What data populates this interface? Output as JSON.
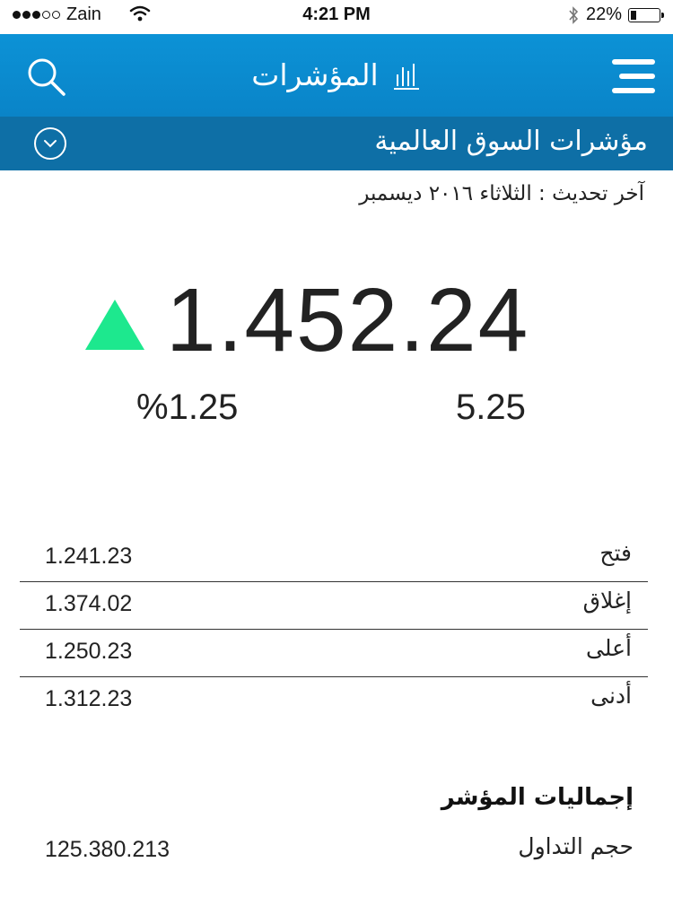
{
  "status_bar": {
    "carrier": "Zain",
    "time": "4:21 PM",
    "battery_text": "22%",
    "battery_level": 0.22,
    "signal_bars_filled": 3,
    "signal_bars_total": 5
  },
  "nav": {
    "title": "المؤشرات",
    "icons": {
      "search": "search-icon",
      "chart": "bar-chart-icon",
      "menu": "hamburger-menu-icon"
    }
  },
  "section": {
    "title": "مؤشرات السوق العالمية",
    "toggle_icon": "chevron-down-icon"
  },
  "last_update": "آخر تحديث : الثلاثاء ٢٠١٦ ديسمبر",
  "index": {
    "value": "1.452.24",
    "direction": "up",
    "change_value": "5.25",
    "change_percent": "%1.25"
  },
  "stats": [
    {
      "label": "فتح",
      "value": "1.241.23"
    },
    {
      "label": "إغلاق",
      "value": "1.374.02"
    },
    {
      "label": "أعلى",
      "value": "1.250.23"
    },
    {
      "label": "أدنى",
      "value": "1.312.23"
    }
  ],
  "totals": {
    "heading": "إجماليات المؤشر",
    "volume_label": "حجم التداول",
    "volume_value": "125.380.213"
  },
  "colors": {
    "nav_blue": "#0a84c8",
    "section_blue": "#0e6fa6",
    "up_green": "#1de88e",
    "text_dark": "#222222"
  }
}
